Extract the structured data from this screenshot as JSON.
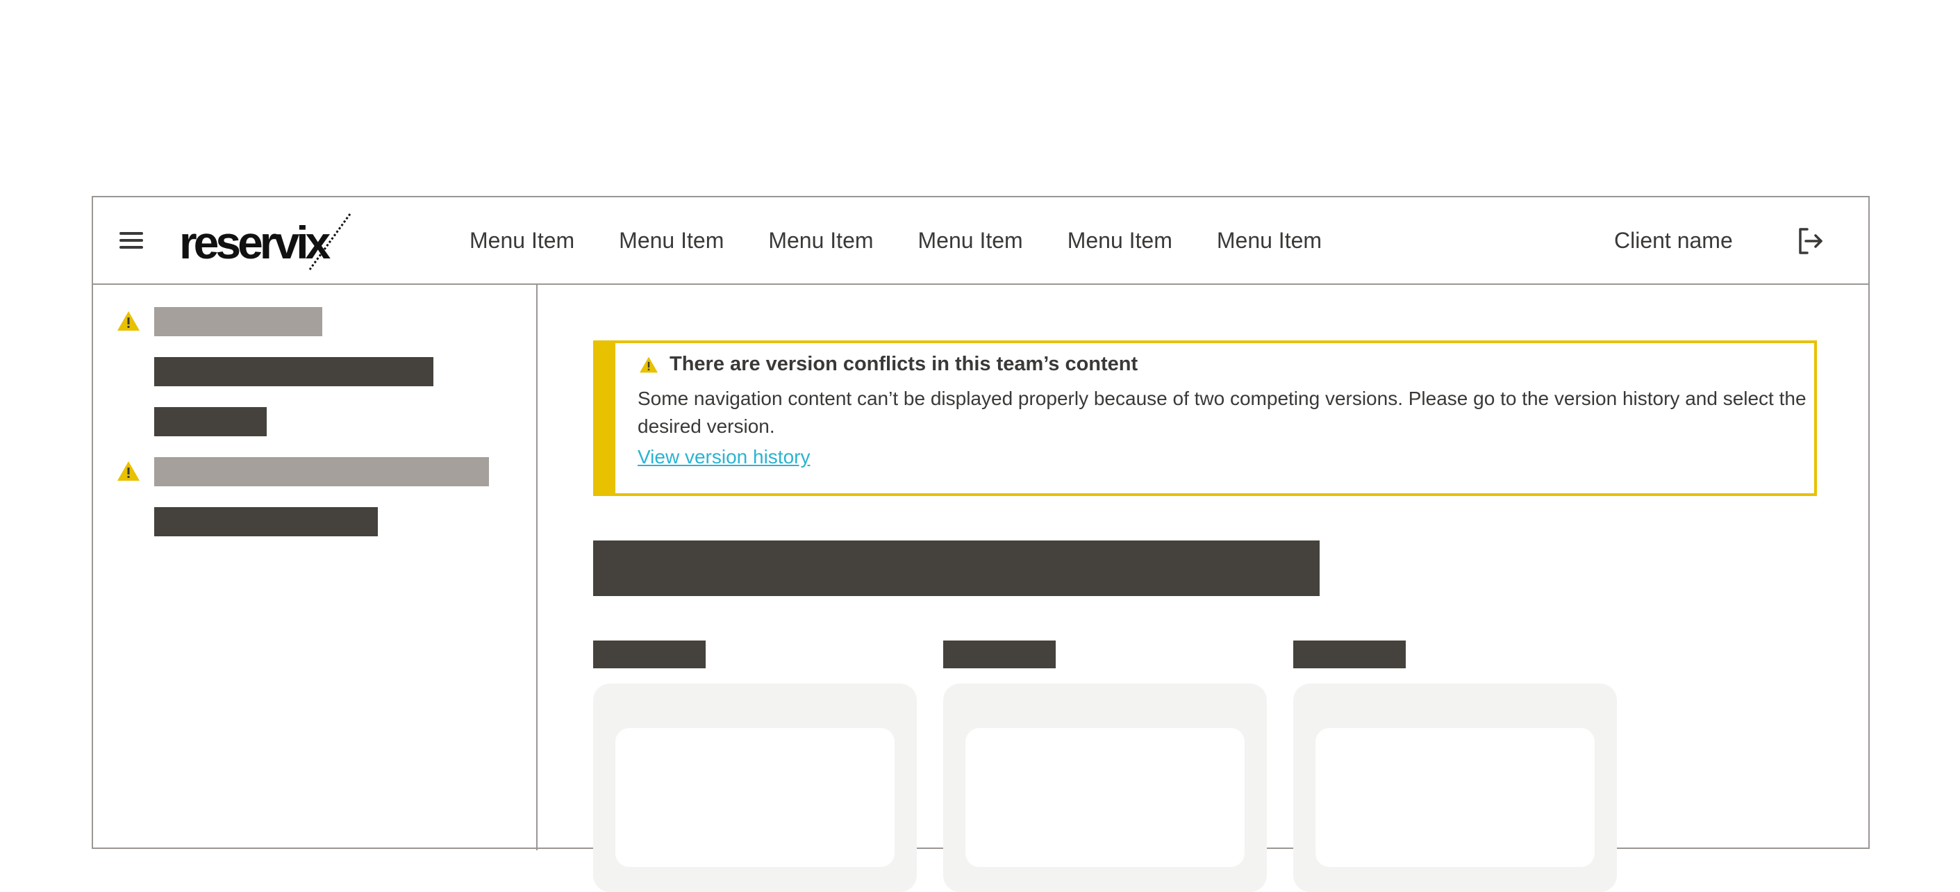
{
  "header": {
    "logo_text": "reservix",
    "menu": [
      {
        "label": "Menu Item"
      },
      {
        "label": "Menu Item"
      },
      {
        "label": "Menu Item"
      },
      {
        "label": "Menu Item"
      },
      {
        "label": "Menu Item"
      },
      {
        "label": "Menu Item"
      }
    ],
    "client_name": "Client name",
    "icons": {
      "menu": "hamburger-icon",
      "logout": "logout-icon"
    }
  },
  "sidebar": {
    "items": [
      {
        "warning": true,
        "state": "muted",
        "icon": "warning-icon"
      },
      {
        "warning": false,
        "state": "normal"
      },
      {
        "warning": false,
        "state": "normal"
      },
      {
        "warning": true,
        "state": "muted",
        "icon": "warning-icon"
      },
      {
        "warning": false,
        "state": "normal"
      }
    ]
  },
  "alert": {
    "icon": "warning-icon",
    "title": "There are version conflicts in this team’s content",
    "body": "Some navigation content can’t be displayed properly because of two competing versions. Please go to the version history and select the desired version.",
    "link": "View version history"
  },
  "colors": {
    "accent_warning": "#e8c100",
    "link": "#2bb3d1",
    "placeholder_dark": "#45423d",
    "placeholder_muted": "#a5a09b",
    "card_bg": "#f3f3f2",
    "border": "#9a9694"
  }
}
